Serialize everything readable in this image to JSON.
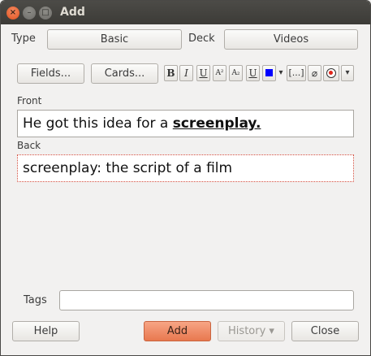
{
  "window": {
    "title": "Add"
  },
  "header": {
    "type_label": "Type",
    "type_value": "Basic",
    "deck_label": "Deck",
    "deck_value": "Videos"
  },
  "toolbar": {
    "fields_label": "Fields...",
    "cards_label": "Cards...",
    "bold": "B",
    "italic": "I",
    "underline": "U",
    "superscript": "A²",
    "subscript": "A₂",
    "clear_format": "U",
    "color_swatch": "#0000ff",
    "more_arrow": "▾",
    "cloze": "[...]",
    "attach": "🖇",
    "record": "⦿",
    "more": "▾"
  },
  "fields": [
    {
      "name": "Front",
      "text_before": "He got this idea for a ",
      "text_highlight": "screenplay."
    },
    {
      "name": "Back",
      "text": "screenplay: the script of a film"
    }
  ],
  "tags": {
    "label": "Tags",
    "value": ""
  },
  "buttons": {
    "help": "Help",
    "add": "Add",
    "history": "History ▾",
    "close": "Close"
  }
}
